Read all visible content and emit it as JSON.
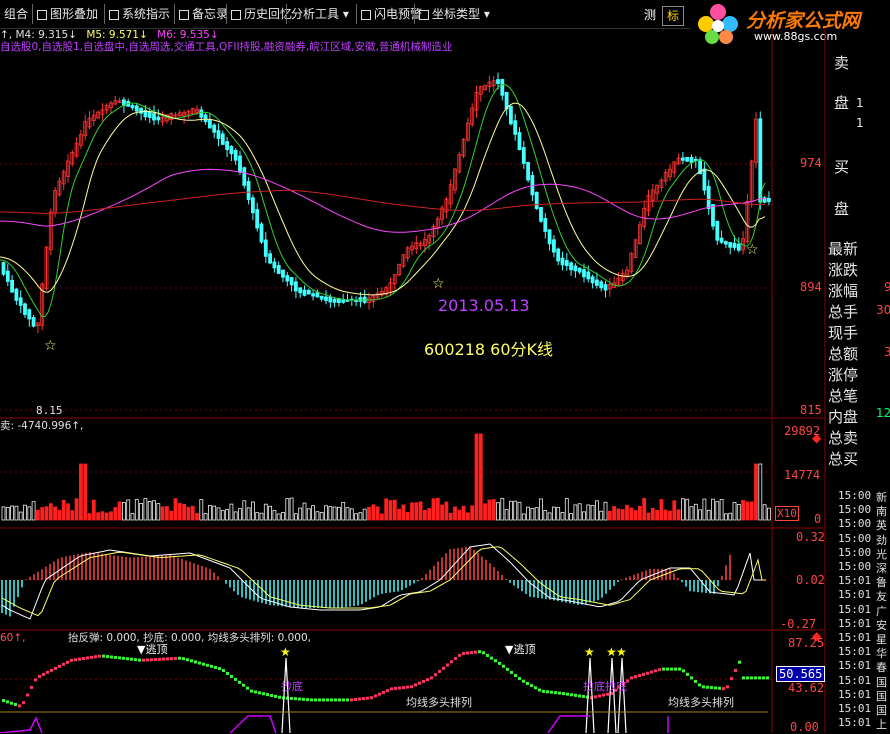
{
  "toolbar": {
    "items": [
      "组合",
      "图形叠加",
      "系统指示",
      "备忘录",
      "历史回忆",
      "分析工具",
      "闪电预警",
      "坐标类型"
    ],
    "right_btn_1": "测",
    "right_btn_2": "标"
  },
  "logo": {
    "main": "分析家公式网",
    "url": "www.88gs.com"
  },
  "ma_line": {
    "m4": "M4: 9.315↓",
    "m5": "M5: 9.571↓",
    "m6": "M6: 9.535↓",
    "colors": {
      "m4": "#e0e0e0",
      "m5": "#ffff66",
      "m6": "#ff44ff"
    }
  },
  "sector_line": "自选股0,自选股1,自选盘中,自选周选,交通工具,QFII持股,融资融券,皖江区域,安徽,普通机械制造业",
  "main_chart": {
    "axis_labels": [
      "974",
      "894",
      "815"
    ],
    "low_label": "8.15",
    "date_note": "2013.05.13",
    "code_note": "600218 60分K线"
  },
  "volume": {
    "header": "卖: -4740.996↑,",
    "axis_labels": [
      "29892",
      "14774"
    ],
    "x10": "X10",
    "zero": "0"
  },
  "macd": {
    "axis_labels": [
      "0.32",
      "0.02",
      "-0.27"
    ]
  },
  "indicator": {
    "header_a": "60↑,",
    "header_b": "抬反弹: 0.000, 抄底: 0.000, 均线多头排列: 0.000,",
    "axis_labels": [
      "87.25",
      "43.62",
      "0.00"
    ],
    "current_value": "50.565",
    "top_marks": [
      "逃顶",
      "逃顶"
    ],
    "bottom_marks": [
      "抄底",
      "抄底抄底"
    ],
    "trend_marks": [
      "均线多头排列",
      "均线多头排列"
    ]
  },
  "right_panel": {
    "orders": [
      "卖",
      "盘",
      "1",
      "1",
      "974",
      "买",
      "盘"
    ],
    "quote_labels": [
      "最新",
      "涨跌",
      "涨幅",
      "总手",
      "现手",
      "总额",
      "涨停",
      "总笔",
      "内盘",
      "总卖",
      "总买"
    ],
    "quote_vals": [
      "9",
      "30",
      "3",
      "12"
    ],
    "ticks": [
      {
        "t": "15:00",
        "c": "新"
      },
      {
        "t": "15:00",
        "c": "南"
      },
      {
        "t": "15:00",
        "c": "英"
      },
      {
        "t": "15:00",
        "c": "劲"
      },
      {
        "t": "15:00",
        "c": "光"
      },
      {
        "t": "15:00",
        "c": "深"
      },
      {
        "t": "15:01",
        "c": "鲁"
      },
      {
        "t": "15:01",
        "c": "友"
      },
      {
        "t": "15:01",
        "c": "广"
      },
      {
        "t": "15:01",
        "c": "安"
      },
      {
        "t": "15:01",
        "c": "星"
      },
      {
        "t": "15:01",
        "c": "华"
      },
      {
        "t": "15:01",
        "c": "春"
      },
      {
        "t": "15:01",
        "c": "国"
      },
      {
        "t": "15:01",
        "c": "国"
      },
      {
        "t": "15:01",
        "c": "国"
      },
      {
        "t": "15:01",
        "c": "上"
      }
    ]
  }
}
